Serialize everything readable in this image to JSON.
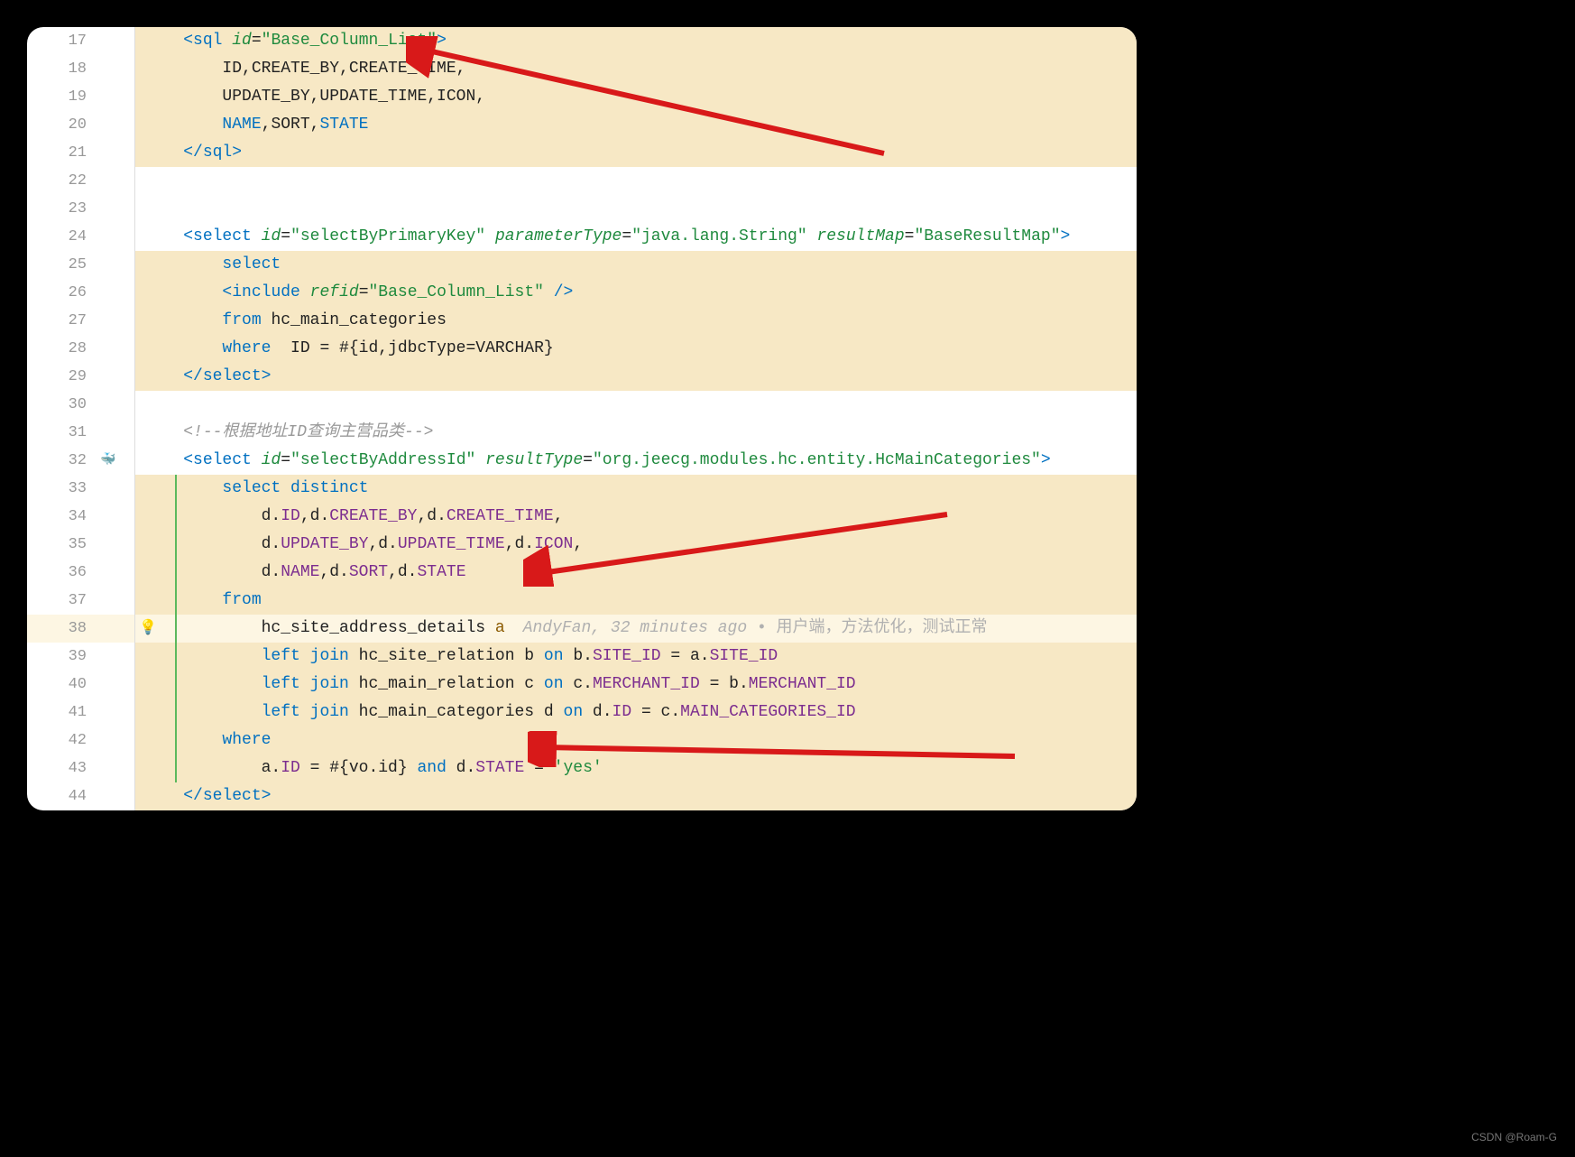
{
  "watermark": "CSDN @Roam-G",
  "blame": {
    "author": "AndyFan",
    "time": "32 minutes ago",
    "message": "用户端，方法优化，测试正常"
  },
  "lines": [
    {
      "n": 17,
      "hl": "yellow",
      "tokens": [
        {
          "t": "    ",
          "c": ""
        },
        {
          "t": "<",
          "c": "tag"
        },
        {
          "t": "sql",
          "c": "tag"
        },
        {
          "t": " ",
          "c": ""
        },
        {
          "t": "id",
          "c": "attr"
        },
        {
          "t": "=",
          "c": "text-black"
        },
        {
          "t": "\"Base_Column_List\"",
          "c": "str"
        },
        {
          "t": ">",
          "c": "tag"
        }
      ]
    },
    {
      "n": 18,
      "hl": "yellow",
      "tokens": [
        {
          "t": "        ID,CREATE_BY,CREATE_TIME,",
          "c": "text-black"
        }
      ]
    },
    {
      "n": 19,
      "hl": "yellow",
      "tokens": [
        {
          "t": "        UPDATE_BY,UPDATE_TIME,ICON,",
          "c": "text-black"
        }
      ]
    },
    {
      "n": 20,
      "hl": "yellow",
      "tokens": [
        {
          "t": "        ",
          "c": ""
        },
        {
          "t": "NAME",
          "c": "kw"
        },
        {
          "t": ",SORT,",
          "c": "text-black"
        },
        {
          "t": "STATE",
          "c": "kw"
        }
      ]
    },
    {
      "n": 21,
      "hl": "yellow",
      "tokens": [
        {
          "t": "    ",
          "c": ""
        },
        {
          "t": "</",
          "c": "tag"
        },
        {
          "t": "sql",
          "c": "tag"
        },
        {
          "t": ">",
          "c": "tag"
        }
      ]
    },
    {
      "n": 22,
      "hl": "",
      "tokens": []
    },
    {
      "n": 23,
      "hl": "",
      "tokens": []
    },
    {
      "n": 24,
      "hl": "",
      "tokens": [
        {
          "t": "    ",
          "c": ""
        },
        {
          "t": "<",
          "c": "tag"
        },
        {
          "t": "select",
          "c": "tag"
        },
        {
          "t": " ",
          "c": ""
        },
        {
          "t": "id",
          "c": "attr"
        },
        {
          "t": "=",
          "c": "text-black"
        },
        {
          "t": "\"selectByPrimaryKey\"",
          "c": "str"
        },
        {
          "t": " ",
          "c": ""
        },
        {
          "t": "parameterType",
          "c": "attr"
        },
        {
          "t": "=",
          "c": "text-black"
        },
        {
          "t": "\"java.lang.String\"",
          "c": "str"
        },
        {
          "t": " ",
          "c": ""
        },
        {
          "t": "resultMap",
          "c": "attr"
        },
        {
          "t": "=",
          "c": "text-black"
        },
        {
          "t": "\"BaseResultMap\"",
          "c": "str"
        },
        {
          "t": ">",
          "c": "tag"
        }
      ]
    },
    {
      "n": 25,
      "hl": "yellow",
      "tokens": [
        {
          "t": "        ",
          "c": ""
        },
        {
          "t": "select",
          "c": "kw"
        }
      ]
    },
    {
      "n": 26,
      "hl": "yellow",
      "tokens": [
        {
          "t": "        ",
          "c": ""
        },
        {
          "t": "<",
          "c": "tag"
        },
        {
          "t": "include",
          "c": "tag"
        },
        {
          "t": " ",
          "c": ""
        },
        {
          "t": "refid",
          "c": "attr"
        },
        {
          "t": "=",
          "c": "text-black"
        },
        {
          "t": "\"Base_Column_List\"",
          "c": "str"
        },
        {
          "t": " />",
          "c": "tag"
        }
      ]
    },
    {
      "n": 27,
      "hl": "yellow",
      "tokens": [
        {
          "t": "        ",
          "c": ""
        },
        {
          "t": "from",
          "c": "kw"
        },
        {
          "t": " hc_main_categories",
          "c": "text-black"
        }
      ]
    },
    {
      "n": 28,
      "hl": "yellow",
      "tokens": [
        {
          "t": "        ",
          "c": ""
        },
        {
          "t": "where",
          "c": "kw"
        },
        {
          "t": "  ID = #{id,jdbcType=VARCHAR}",
          "c": "text-black"
        }
      ]
    },
    {
      "n": 29,
      "hl": "yellow",
      "tokens": [
        {
          "t": "    ",
          "c": ""
        },
        {
          "t": "</",
          "c": "tag"
        },
        {
          "t": "select",
          "c": "tag"
        },
        {
          "t": ">",
          "c": "tag"
        }
      ]
    },
    {
      "n": 30,
      "hl": "",
      "tokens": []
    },
    {
      "n": 31,
      "hl": "",
      "tokens": [
        {
          "t": "    ",
          "c": ""
        },
        {
          "t": "<!--根据地址ID查询主营品类-->",
          "c": "comment"
        }
      ]
    },
    {
      "n": 32,
      "hl": "",
      "icon": "company",
      "tokens": [
        {
          "t": "    ",
          "c": ""
        },
        {
          "t": "<",
          "c": "tag"
        },
        {
          "t": "select",
          "c": "tag"
        },
        {
          "t": " ",
          "c": ""
        },
        {
          "t": "id",
          "c": "attr"
        },
        {
          "t": "=",
          "c": "text-black"
        },
        {
          "t": "\"selectByAddressId\"",
          "c": "str"
        },
        {
          "t": " ",
          "c": ""
        },
        {
          "t": "resultType",
          "c": "attr"
        },
        {
          "t": "=",
          "c": "text-black"
        },
        {
          "t": "\"org.jeecg.modules.hc.entity.HcMainCategories\"",
          "c": "str"
        },
        {
          "t": ">",
          "c": "tag"
        }
      ]
    },
    {
      "n": 33,
      "hl": "yellow",
      "guide": true,
      "tokens": [
        {
          "t": "        ",
          "c": ""
        },
        {
          "t": "select",
          "c": "kw"
        },
        {
          "t": " ",
          "c": ""
        },
        {
          "t": "distinct",
          "c": "kw"
        }
      ]
    },
    {
      "n": 34,
      "hl": "yellow",
      "guide": true,
      "tokens": [
        {
          "t": "            d.",
          "c": "text-black"
        },
        {
          "t": "ID",
          "c": "func"
        },
        {
          "t": ",d.",
          "c": "text-black"
        },
        {
          "t": "CREATE_BY",
          "c": "func"
        },
        {
          "t": ",d.",
          "c": "text-black"
        },
        {
          "t": "CREATE_TIME",
          "c": "func"
        },
        {
          "t": ",",
          "c": "text-black"
        }
      ]
    },
    {
      "n": 35,
      "hl": "yellow",
      "guide": true,
      "tokens": [
        {
          "t": "            d.",
          "c": "text-black"
        },
        {
          "t": "UPDATE_BY",
          "c": "func"
        },
        {
          "t": ",d.",
          "c": "text-black"
        },
        {
          "t": "UPDATE_TIME",
          "c": "func"
        },
        {
          "t": ",d.",
          "c": "text-black"
        },
        {
          "t": "ICON",
          "c": "func"
        },
        {
          "t": ",",
          "c": "text-black"
        }
      ]
    },
    {
      "n": 36,
      "hl": "yellow",
      "guide": true,
      "tokens": [
        {
          "t": "            d.",
          "c": "text-black"
        },
        {
          "t": "NAME",
          "c": "func"
        },
        {
          "t": ",d.",
          "c": "text-black"
        },
        {
          "t": "SORT",
          "c": "func"
        },
        {
          "t": ",d.",
          "c": "text-black"
        },
        {
          "t": "STATE",
          "c": "func"
        }
      ]
    },
    {
      "n": 37,
      "hl": "yellow",
      "guide": true,
      "tokens": [
        {
          "t": "        ",
          "c": ""
        },
        {
          "t": "from",
          "c": "kw"
        }
      ]
    },
    {
      "n": 38,
      "hl": "active",
      "guide": true,
      "icon": "bulb",
      "blame": true,
      "tokens": [
        {
          "t": "            hc_site_address_details ",
          "c": "text-black"
        },
        {
          "t": "a",
          "c": "field"
        }
      ]
    },
    {
      "n": 39,
      "hl": "yellow",
      "guide": true,
      "tokens": [
        {
          "t": "            ",
          "c": ""
        },
        {
          "t": "left",
          "c": "kw"
        },
        {
          "t": " ",
          "c": ""
        },
        {
          "t": "join",
          "c": "kw"
        },
        {
          "t": " hc_site_relation b ",
          "c": "text-black"
        },
        {
          "t": "on",
          "c": "kw"
        },
        {
          "t": " b.",
          "c": "text-black"
        },
        {
          "t": "SITE_ID",
          "c": "func"
        },
        {
          "t": " = a.",
          "c": "text-black"
        },
        {
          "t": "SITE_ID",
          "c": "func"
        }
      ]
    },
    {
      "n": 40,
      "hl": "yellow",
      "guide": true,
      "tokens": [
        {
          "t": "            ",
          "c": ""
        },
        {
          "t": "left",
          "c": "kw"
        },
        {
          "t": " ",
          "c": ""
        },
        {
          "t": "join",
          "c": "kw"
        },
        {
          "t": " hc_main_relation c ",
          "c": "text-black"
        },
        {
          "t": "on",
          "c": "kw"
        },
        {
          "t": " c.",
          "c": "text-black"
        },
        {
          "t": "MERCHANT_ID",
          "c": "func"
        },
        {
          "t": " = b.",
          "c": "text-black"
        },
        {
          "t": "MERCHANT_ID",
          "c": "func"
        }
      ]
    },
    {
      "n": 41,
      "hl": "yellow",
      "guide": true,
      "tokens": [
        {
          "t": "            ",
          "c": ""
        },
        {
          "t": "left",
          "c": "kw"
        },
        {
          "t": " ",
          "c": ""
        },
        {
          "t": "join",
          "c": "kw"
        },
        {
          "t": " hc_main_categories d ",
          "c": "text-black"
        },
        {
          "t": "on",
          "c": "kw"
        },
        {
          "t": " d.",
          "c": "text-black"
        },
        {
          "t": "ID",
          "c": "func"
        },
        {
          "t": " = c.",
          "c": "text-black"
        },
        {
          "t": "MAIN_CATEGORIES_ID",
          "c": "func"
        }
      ]
    },
    {
      "n": 42,
      "hl": "yellow",
      "guide": true,
      "tokens": [
        {
          "t": "        ",
          "c": ""
        },
        {
          "t": "where",
          "c": "kw"
        }
      ]
    },
    {
      "n": 43,
      "hl": "yellow",
      "guide": true,
      "tokens": [
        {
          "t": "            a.",
          "c": "text-black"
        },
        {
          "t": "ID",
          "c": "func"
        },
        {
          "t": " = #{vo.id} ",
          "c": "text-black"
        },
        {
          "t": "and",
          "c": "kw"
        },
        {
          "t": " d.",
          "c": "text-black"
        },
        {
          "t": "STATE",
          "c": "func"
        },
        {
          "t": " = ",
          "c": "text-black"
        },
        {
          "t": "'yes'",
          "c": "str"
        }
      ]
    },
    {
      "n": 44,
      "hl": "yellow",
      "tokens": [
        {
          "t": "    ",
          "c": ""
        },
        {
          "t": "</",
          "c": "tag"
        },
        {
          "t": "select",
          "c": "tag"
        },
        {
          "t": ">",
          "c": "tag"
        }
      ]
    }
  ]
}
